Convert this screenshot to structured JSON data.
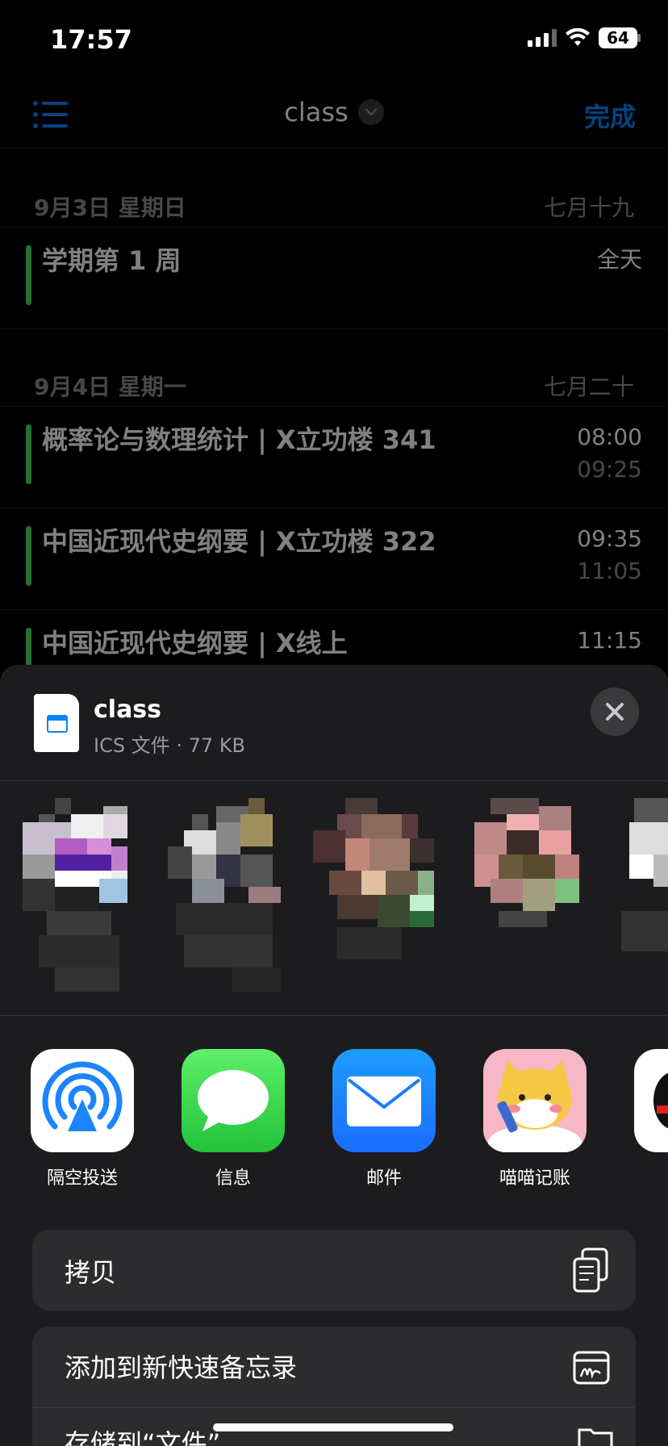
{
  "status_bar": {
    "time": "17:57",
    "battery": "64"
  },
  "nav": {
    "title": "class",
    "done": "完成"
  },
  "calendar": {
    "days": [
      {
        "date": "9月3日 星期日",
        "lunar": "七月十九",
        "events": [
          {
            "title": "学期第 1 周",
            "all_day": "全天"
          }
        ]
      },
      {
        "date": "9月4日 星期一",
        "lunar": "七月二十",
        "events": [
          {
            "title": "概率论与数理统计 | X立功楼 341",
            "start": "08:00",
            "end": "09:25"
          },
          {
            "title": "中国近现代史纲要 | X立功楼 322",
            "start": "09:35",
            "end": "11:05"
          },
          {
            "title": "中国近现代史纲要 | X线上",
            "start": "11:15"
          }
        ]
      }
    ]
  },
  "share_sheet": {
    "file": {
      "name": "class",
      "meta": "ICS 文件 · 77 KB"
    },
    "apps": [
      {
        "label": "隔空投送",
        "icon": "airdrop-icon"
      },
      {
        "label": "信息",
        "icon": "messages-icon"
      },
      {
        "label": "邮件",
        "icon": "mail-icon"
      },
      {
        "label": "喵喵记账",
        "icon": "miaomiao-app-icon"
      }
    ],
    "actions": [
      {
        "label": "拷贝",
        "icon": "copy-icon"
      },
      {
        "label": "添加到新快速备忘录",
        "icon": "quick-note-icon"
      },
      {
        "label": "存储到“文件”",
        "icon": "folder-icon"
      }
    ]
  }
}
